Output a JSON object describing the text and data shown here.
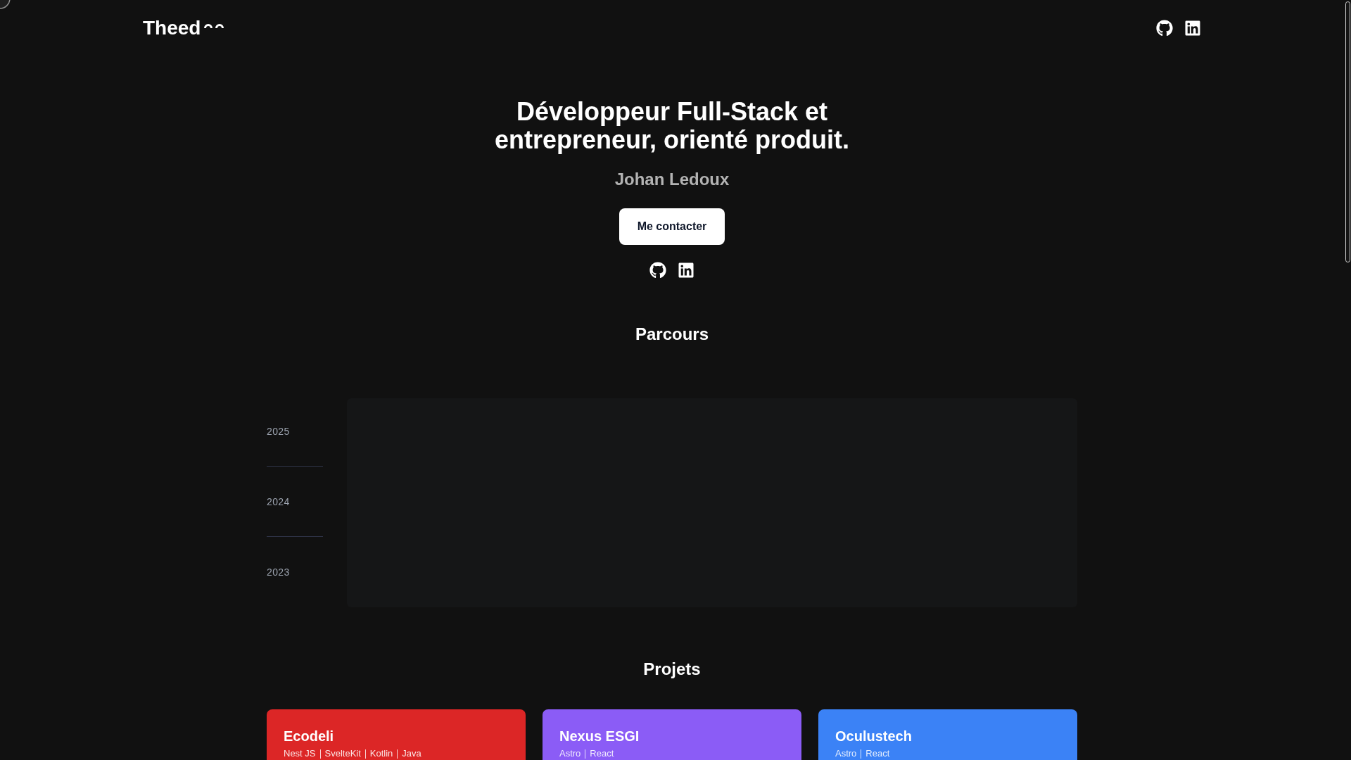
{
  "header": {
    "logo": "Theed"
  },
  "hero": {
    "title": "Développeur Full-Stack et entrepreneur, orienté produit.",
    "name": "Johan Ledoux",
    "button": "Me contacter"
  },
  "timeline": {
    "title": "Parcours",
    "years": [
      "2025",
      "2024",
      "2023"
    ]
  },
  "projects": {
    "title": "Projets",
    "items": [
      {
        "name": "Ecodeli",
        "color": "#dc2626",
        "tags": [
          "Nest JS",
          "SvelteKit",
          "Kotlin",
          "Java"
        ]
      },
      {
        "name": "Nexus ESGI",
        "color": "#8b5cf6",
        "tags": [
          "Astro",
          "React"
        ]
      },
      {
        "name": "Oculustech",
        "color": "#3b82f6",
        "tags": [
          "Astro",
          "React"
        ]
      }
    ]
  }
}
